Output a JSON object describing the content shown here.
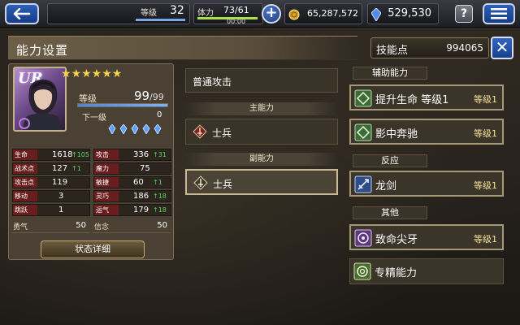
{
  "topbar": {
    "level_label": "等级",
    "level_value": "32",
    "level_progress": 0.98,
    "stamina_label": "体力",
    "stamina_value": "73/61",
    "stamina_progress": 1.0,
    "stamina_timer": "00:00",
    "gil": "65,287,572",
    "gems": "529,530",
    "help_label": "?"
  },
  "header": {
    "title": "能力设置",
    "skill_points_label": "技能点",
    "skill_points_value": "994065",
    "close_label": "✕"
  },
  "character": {
    "rarity": "UR",
    "stars": "★★★★★★",
    "level_label": "等级",
    "level_value": "99",
    "level_max": "/99",
    "xp_progress": 1.0,
    "next_label": "下一级",
    "next_value": "0",
    "stats": [
      {
        "left_name": "生命",
        "left_value": "1618",
        "left_bonus": "↑105",
        "right_name": "攻击",
        "right_value": "336",
        "right_bonus": "↑31"
      },
      {
        "left_name": "战术点",
        "left_value": "127",
        "left_bonus": "↑1",
        "right_name": "魔力",
        "right_value": "75",
        "right_bonus": ""
      },
      {
        "left_name": "攻击点",
        "left_value": "119",
        "left_bonus": "",
        "right_name": "敏捷",
        "right_value": "60",
        "right_bonus": "↑1"
      },
      {
        "left_name": "移动",
        "left_value": "3",
        "left_bonus": "",
        "right_name": "灵巧",
        "right_value": "186",
        "right_bonus": "↑18"
      },
      {
        "left_name": "跳跃",
        "left_value": "1",
        "left_bonus": "",
        "right_name": "运气",
        "right_value": "179",
        "right_bonus": "↑18"
      }
    ],
    "bravery_label": "勇气",
    "bravery_value": "50",
    "faith_label": "信念",
    "faith_value": "50",
    "status_button": "状态详细"
  },
  "middle": {
    "normal_attack": "普通攻击",
    "primary_label": "主能力",
    "primary_value": "士兵",
    "secondary_label": "副能力",
    "secondary_value": "士兵"
  },
  "right": {
    "support_label": "辅助能力",
    "support_items": [
      {
        "label": "提升生命 等级1",
        "level": "等级1"
      },
      {
        "label": "影中奔驰",
        "level": "等级1"
      }
    ],
    "reaction_label": "反应",
    "reaction_item": {
      "label": "龙剑",
      "level": "等级1"
    },
    "other_label": "其他",
    "other_items": [
      {
        "label": "致命尖牙",
        "level": "等级1"
      },
      {
        "label": "专精能力",
        "level": ""
      }
    ]
  },
  "colors": {
    "panel_bg": "#4a4034",
    "stat_name_bg": "#6a1d1d",
    "bonus_green": "#56d860",
    "star_gold": "#f4d24a",
    "button_blue": "#1f4ea6"
  }
}
